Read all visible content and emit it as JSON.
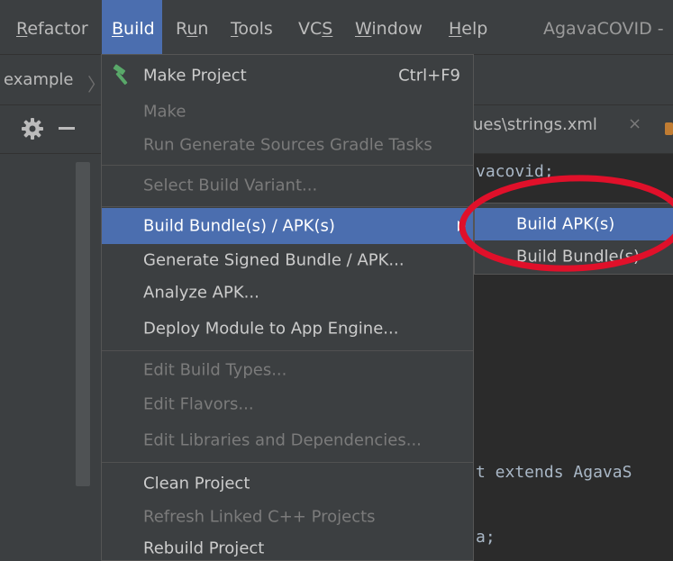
{
  "menubar": {
    "items": [
      {
        "label": "Refactor",
        "ul": "R",
        "rest": "efactor"
      },
      {
        "label": "Build",
        "ul": "B",
        "rest": "uild"
      },
      {
        "label": "Run",
        "pre": "R",
        "ul": "u",
        "rest": "n"
      },
      {
        "label": "Tools",
        "ul": "T",
        "rest": "ools"
      },
      {
        "label": "VCS",
        "pre": "VC",
        "ul": "S",
        "rest": ""
      },
      {
        "label": "Window",
        "ul": "W",
        "rest": "indow"
      },
      {
        "label": "Help",
        "ul": "H",
        "rest": "elp"
      }
    ],
    "project_title": "AgavaCOVID -"
  },
  "breadcrumb": {
    "item": "example"
  },
  "tab": {
    "label": "ues\\strings.xml",
    "close": "×"
  },
  "code": {
    "line1": "vacovid;",
    "line2_kw": "t extends",
    "line2_rest": "AgavaS",
    "line3": "a;"
  },
  "build_menu": {
    "items": [
      {
        "label": "Make Project",
        "shortcut": "Ctrl+F9",
        "enabled": true,
        "icon": "hammer-icon"
      },
      {
        "label": "Make",
        "enabled": false
      },
      {
        "label": "Run Generate Sources Gradle Tasks",
        "enabled": false
      },
      {
        "label": "Select Build Variant...",
        "enabled": false
      },
      {
        "label": "Build Bundle(s) / APK(s)",
        "enabled": true,
        "highlighted": true,
        "submenu": true
      },
      {
        "label": "Generate Signed Bundle / APK...",
        "enabled": true
      },
      {
        "label": "Analyze APK...",
        "enabled": true
      },
      {
        "label": "Deploy Module to App Engine...",
        "enabled": true
      },
      {
        "label": "Edit Build Types...",
        "enabled": false
      },
      {
        "label": "Edit Flavors...",
        "enabled": false
      },
      {
        "label": "Edit Libraries and Dependencies...",
        "enabled": false
      },
      {
        "label": "Clean Project",
        "enabled": true
      },
      {
        "label": "Refresh Linked C++ Projects",
        "enabled": false
      },
      {
        "label": "Rebuild Project",
        "enabled": true
      }
    ]
  },
  "submenu": {
    "items": [
      {
        "label": "Build APK(s)",
        "highlighted": true
      },
      {
        "label": "Build Bundle(s)",
        "highlighted": false
      }
    ]
  },
  "colors": {
    "accent": "#4b6eaf",
    "annotation": "#e0102a",
    "menu_bg": "#3c3f41",
    "editor_bg": "#2b2b2b",
    "keyword": "#cc7832"
  },
  "annotation": {
    "shape": "ellipse",
    "target": "Build APK(s)"
  }
}
